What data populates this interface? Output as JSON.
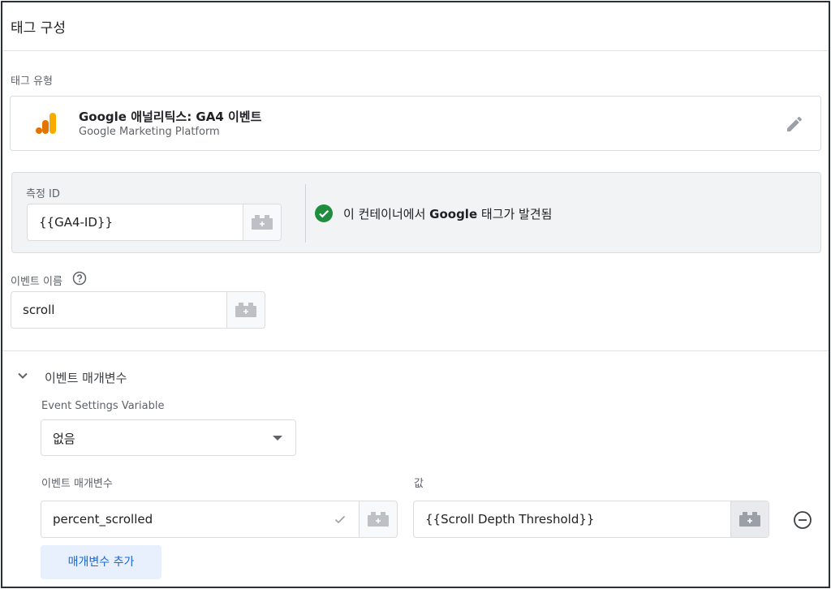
{
  "header": {
    "title": "태그 구성"
  },
  "tag_type": {
    "label": "태그 유형",
    "name": "Google 애널리틱스: GA4 이벤트",
    "platform": "Google Marketing Platform",
    "icon": "google-analytics-icon"
  },
  "measurement": {
    "label": "측정 ID",
    "value": "{{GA4-ID}}",
    "status_prefix": "이 컨테이너에서 ",
    "status_bold": "Google",
    "status_suffix": " 태그가 발견됨"
  },
  "event_name": {
    "label": "이벤트 이름",
    "value": "scroll"
  },
  "event_params": {
    "section_title": "이벤트 매개변수",
    "settings_label": "Event Settings Variable",
    "settings_value": "없음",
    "param_label": "이벤트 매개변수",
    "value_label": "값",
    "rows": [
      {
        "param": "percent_scrolled",
        "value": "{{Scroll Depth Threshold}}"
      }
    ],
    "add_button": "매개변수 추가"
  },
  "colors": {
    "accent": "#1967d2",
    "success": "#1e8e3e",
    "ga_orange": "#f9ab00",
    "ga_dark_orange": "#e37400"
  }
}
